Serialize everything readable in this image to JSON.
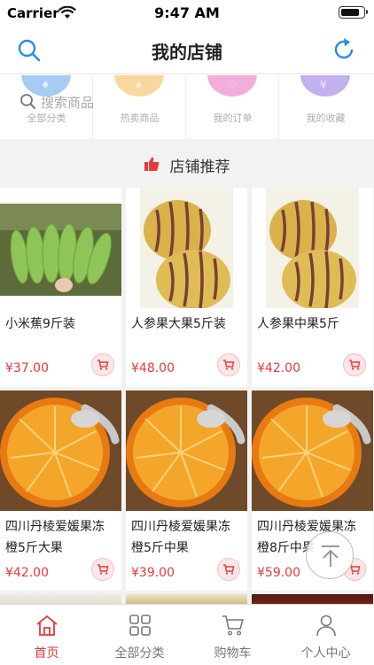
{
  "status_bar": {
    "carrier": "Carrier",
    "time": "9:47 AM"
  },
  "navbar": {
    "title": "我的店铺",
    "left_icon": "search-icon",
    "right_icon": "refresh-icon"
  },
  "search_overlay": {
    "placeholder": "搜索商品"
  },
  "quick_links": [
    {
      "label": "全部分类",
      "color": "#3a8ee6",
      "symbol": "♦"
    },
    {
      "label": "热卖商品",
      "color": "#f5a623",
      "symbol": "★"
    },
    {
      "label": "我的订单",
      "color": "#e24bb0",
      "symbol": "♡"
    },
    {
      "label": "我的收藏",
      "color": "#7b4fd9",
      "symbol": "¥"
    }
  ],
  "section": {
    "title": "店铺推荐",
    "icon": "thumbs-up-icon",
    "accent": "#e8393b"
  },
  "products": [
    {
      "name": "小米蕉9斤装",
      "price": "¥37.00",
      "image": "banana"
    },
    {
      "name": "人参果大果5斤装",
      "price": "¥48.00",
      "image": "pepino"
    },
    {
      "name": "人参果中果5斤",
      "price": "¥42.00",
      "image": "pepino"
    },
    {
      "name": "四川丹棱爱媛果冻橙5斤大果",
      "price": "¥42.00",
      "image": "orange"
    },
    {
      "name": "四川丹棱爱媛果冻橙5斤中果",
      "price": "¥39.00",
      "image": "orange"
    },
    {
      "name": "四川丹棱爱媛果冻橙8斤中果",
      "price": "¥59.00",
      "image": "orange"
    }
  ],
  "tabbar": [
    {
      "label": "首页",
      "icon": "home-icon",
      "active": true
    },
    {
      "label": "全部分类",
      "icon": "grid-icon",
      "active": false
    },
    {
      "label": "购物车",
      "icon": "cart-icon",
      "active": false
    },
    {
      "label": "个人中心",
      "icon": "person-icon",
      "active": false
    }
  ],
  "colors": {
    "accent": "#e8393b",
    "price": "#e8393b"
  }
}
